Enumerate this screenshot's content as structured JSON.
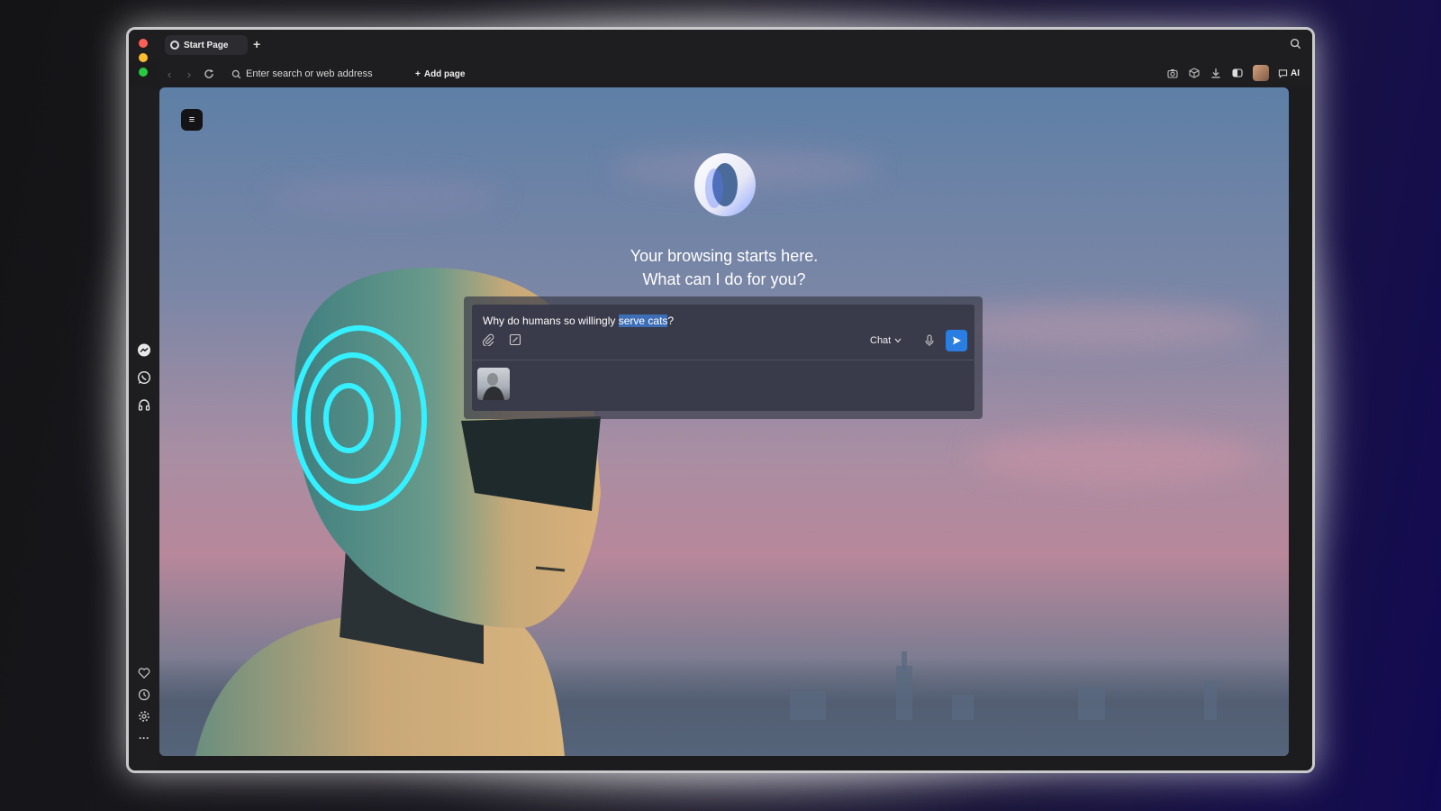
{
  "browser": {
    "tab": {
      "title": "Start Page"
    },
    "new_tab_label": "+",
    "address_bar": {
      "placeholder": "Enter search or web address"
    },
    "add_page_label": "Add page",
    "ai_label": "AI",
    "traffic_lights": [
      "#ff5f57",
      "#febc2e",
      "#28c840"
    ]
  },
  "start_page": {
    "headline_line1": "Your browsing starts here.",
    "headline_line2": "What can I do for you?",
    "menu_icon": "hamburger-icon"
  },
  "chat": {
    "prompt_before": "Why do humans so willingly ",
    "prompt_selected": "serve cats",
    "prompt_after": "?",
    "mode": "Chat",
    "send_color": "#2a7de1",
    "selection_color": "#3d6fb8"
  },
  "sidebar": {
    "top_icons": [
      "messenger-icon",
      "whatsapp-icon",
      "music-icon"
    ],
    "bottom_icons": [
      "heart-icon",
      "history-icon",
      "settings-icon",
      "more-icon"
    ]
  },
  "colors": {
    "accent": "#2a7de1",
    "robot_ring": "#35f0ff"
  }
}
